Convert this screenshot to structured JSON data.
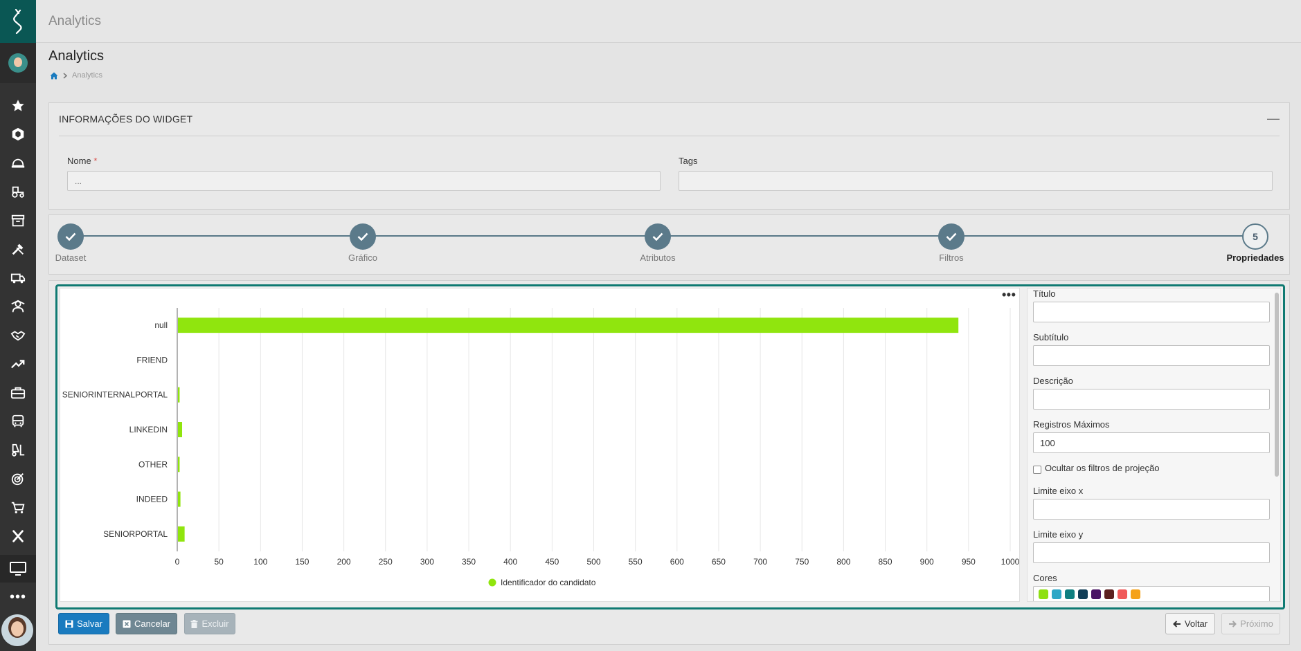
{
  "header": {
    "app_title": "Analytics"
  },
  "page": {
    "title": "Analytics",
    "breadcrumb": {
      "current": "Analytics"
    }
  },
  "widget_info": {
    "heading": "INFORMAÇÕES DO WIDGET",
    "name_label": "Nome",
    "name_required_marker": "*",
    "name_value": "...",
    "tags_label": "Tags",
    "tags_value": ""
  },
  "steps": [
    {
      "label": "Dataset",
      "state": "done"
    },
    {
      "label": "Gráfico",
      "state": "done"
    },
    {
      "label": "Atributos",
      "state": "done"
    },
    {
      "label": "Filtros",
      "state": "done"
    },
    {
      "label": "Propriedades",
      "number": "5",
      "state": "active"
    }
  ],
  "chart_data": {
    "type": "bar",
    "orientation": "horizontal",
    "categories": [
      "null",
      "FRIEND",
      "SENIORINTERNALPORTAL",
      "LINKEDIN",
      "OTHER",
      "INDEED",
      "SENIORPORTAL"
    ],
    "series": [
      {
        "name": "Identificador do candidato",
        "values": [
          937,
          0,
          2,
          5,
          2,
          3,
          8
        ],
        "color": "#90e50e"
      }
    ],
    "xlim": [
      0,
      1000
    ],
    "xticks": [
      0,
      50,
      100,
      150,
      200,
      250,
      300,
      350,
      400,
      450,
      500,
      550,
      600,
      650,
      700,
      750,
      800,
      850,
      900,
      950,
      1000
    ],
    "grid": true,
    "legend_position": "bottom-center"
  },
  "properties": {
    "title_label": "Título",
    "title_value": "",
    "subtitle_label": "Subtítulo",
    "subtitle_value": "",
    "description_label": "Descrição",
    "description_value": "",
    "max_records_label": "Registros Máximos",
    "max_records_value": "100",
    "hide_filters_label": "Ocultar os filtros de projeção",
    "x_limit_label": "Limite eixo x",
    "x_limit_value": "",
    "y_limit_label": "Limite eixo y",
    "y_limit_value": "",
    "colors_label": "Cores",
    "colors": [
      "#8ee012",
      "#2ea7c6",
      "#0f7f80",
      "#123f57",
      "#4a1464",
      "#5c201f",
      "#f05a5a",
      "#f5a21a"
    ]
  },
  "actions": {
    "save": "Salvar",
    "cancel": "Cancelar",
    "delete": "Excluir",
    "back": "Voltar",
    "next": "Próximo"
  },
  "sidebar_icons": [
    "star-icon",
    "cube-icon",
    "hardhat-icon",
    "tractor-icon",
    "archive-icon",
    "tools-icon",
    "truck-icon",
    "students-icon",
    "handshake-icon",
    "trend-up-icon",
    "briefcase-icon",
    "bus-icon",
    "forklift-icon",
    "target-icon",
    "cart-icon",
    "x-tool-icon"
  ]
}
